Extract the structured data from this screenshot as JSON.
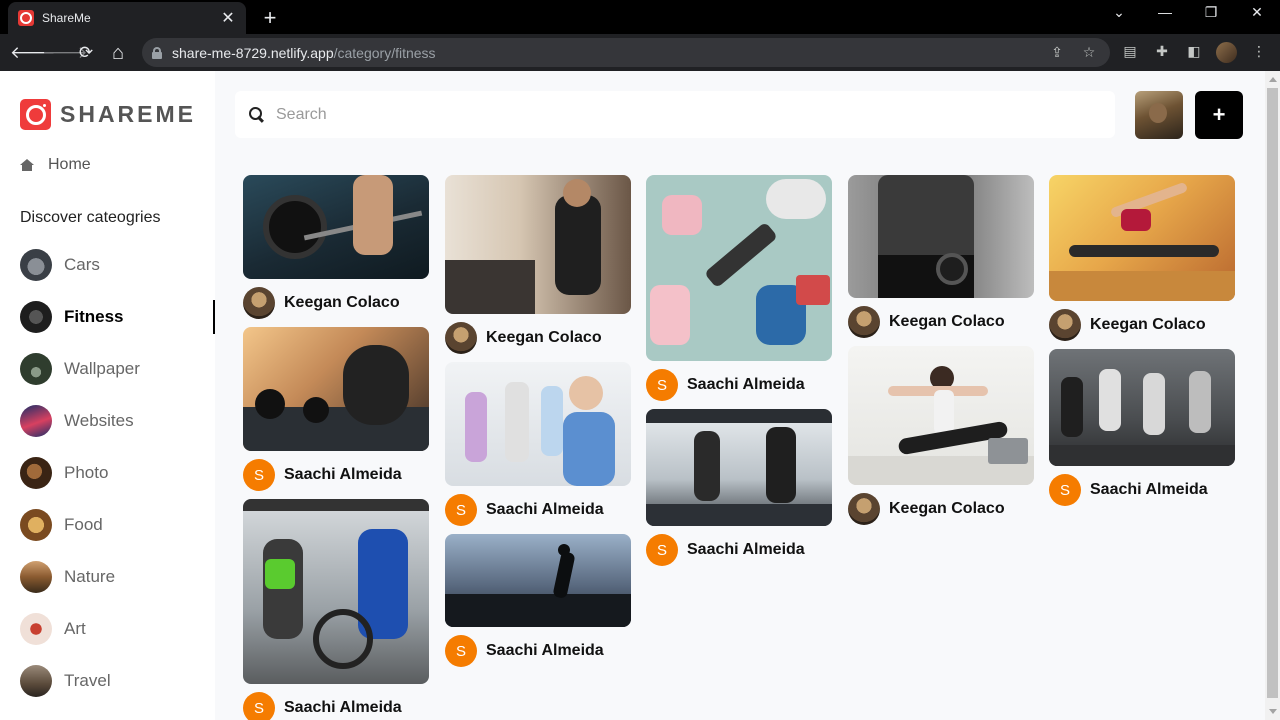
{
  "browser": {
    "tab_title": "ShareMe",
    "new_tab": "+",
    "tab_close": "✕",
    "url_host": "share-me-8729.netlify.app",
    "url_path": "/category/fitness",
    "controls": {
      "back": "🡐",
      "forward": "🡒",
      "reload": "⟳",
      "home": "⌂",
      "minimize": "—",
      "restore": "❐",
      "close": "✕",
      "tabsearch": "⌄",
      "menu": "⋮"
    }
  },
  "app": {
    "logo_text": "SHAREME",
    "nav_home": "Home",
    "discover_heading": "Discover cateogries",
    "categories": [
      {
        "label": "Cars",
        "thumb": "#4a5058"
      },
      {
        "label": "Fitness",
        "thumb": "#2b2b2b",
        "active": true
      },
      {
        "label": "Wallpaper",
        "thumb": "#3d4a3a"
      },
      {
        "label": "Websites",
        "thumb": "#1f3f7a"
      },
      {
        "label": "Photo",
        "thumb": "#5a3a22"
      },
      {
        "label": "Food",
        "thumb": "#a0703a"
      },
      {
        "label": "Nature",
        "thumb": "#7a5a3a"
      },
      {
        "label": "Art",
        "thumb": "#d8a08a"
      },
      {
        "label": "Travel",
        "thumb": "#6a5a4a"
      }
    ],
    "search_placeholder": "Search",
    "add_button": "+",
    "accent_color": "#f57c00"
  },
  "pins": [
    {
      "author": "Keegan Colaco",
      "avatar": "photo",
      "image": "barbell-deadlift-icon"
    },
    {
      "author": "Saachi Almeida",
      "avatar": "S",
      "image": "resting-with-dumbbells-icon"
    },
    {
      "author": "Saachi Almeida",
      "avatar": "S",
      "image": "battle-ropes-icon"
    },
    {
      "author": "Keegan Colaco",
      "avatar": "photo",
      "image": "gym-treadmill-runner-icon"
    },
    {
      "author": "Saachi Almeida",
      "avatar": "S",
      "image": "senior-fitness-class-icon"
    },
    {
      "author": "Saachi Almeida",
      "avatar": "S",
      "image": "sunset-runner-icon"
    },
    {
      "author": "Saachi Almeida",
      "avatar": "S",
      "image": "dumbbells-flatlay-icon"
    },
    {
      "author": "Saachi Almeida",
      "avatar": "S",
      "image": "treadmills-window-icon"
    },
    {
      "author": "Keegan Colaco",
      "avatar": "photo",
      "image": "abs-dumbbell-bw-icon"
    },
    {
      "author": "Keegan Colaco",
      "avatar": "photo",
      "image": "yoga-lunge-laptop-icon"
    },
    {
      "author": "Keegan Colaco",
      "avatar": "photo",
      "image": "stretching-woman-icon"
    },
    {
      "author": "Saachi Almeida",
      "avatar": "S",
      "image": "group-lunges-icon"
    }
  ]
}
